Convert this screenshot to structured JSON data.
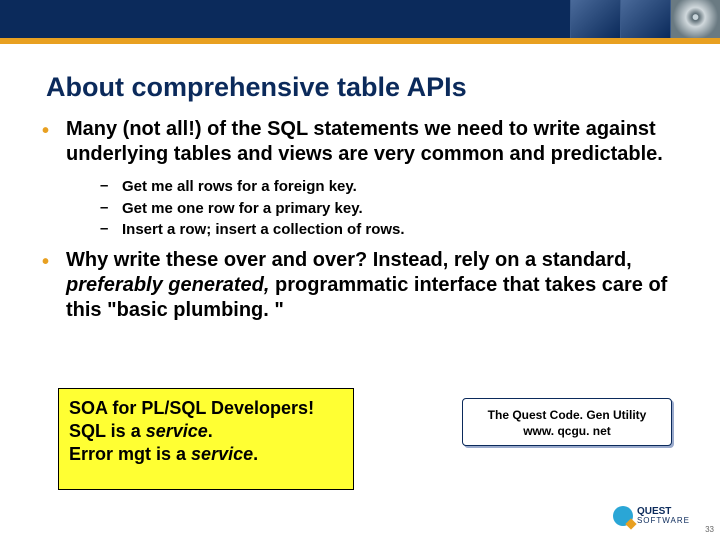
{
  "title": "About comprehensive table APIs",
  "bullets": [
    {
      "text": "Many (not all!) of the SQL statements we need to write against underlying tables and views are very common and predictable.",
      "subs": [
        "Get me all rows for a foreign key.",
        "Get me one row for a primary key.",
        "Insert a row; insert a collection of rows."
      ]
    },
    {
      "text_html": "Why write these over and over? Instead, rely on a standard, <em class='it'>preferably generated,</em> programmatic interface that takes care of this \"basic plumbing. \""
    }
  ],
  "soa_box": {
    "line1": "SOA for PL/SQL Developers!",
    "line2_pre": "SQL is a ",
    "line2_it": "service",
    "line2_post": ".",
    "line3_pre": "Error mgt is a ",
    "line3_it": "service",
    "line3_post": "."
  },
  "quest_box": {
    "line1": "The Quest Code. Gen Utility",
    "line2": "www. qcgu. net"
  },
  "logo": {
    "brand": "QUEST",
    "sub": "SOFTWARE"
  },
  "page_number": "33"
}
